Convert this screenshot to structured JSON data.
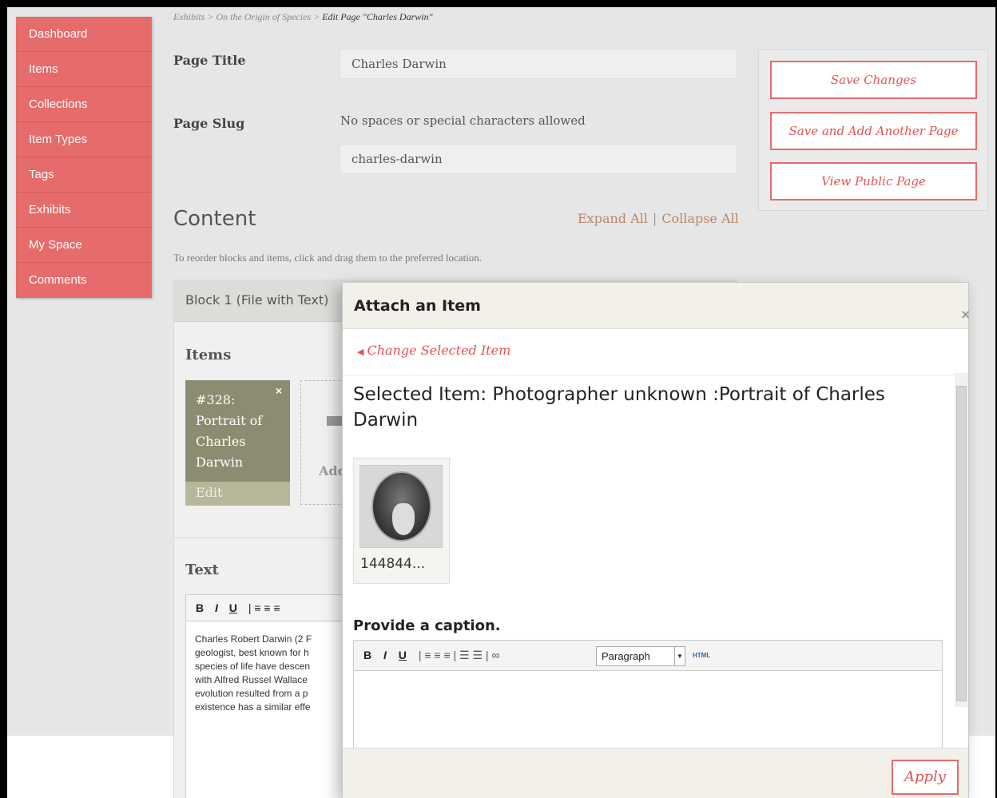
{
  "sidebar": {
    "items": [
      {
        "label": "Dashboard"
      },
      {
        "label": "Items"
      },
      {
        "label": "Collections"
      },
      {
        "label": "Item Types"
      },
      {
        "label": "Tags"
      },
      {
        "label": "Exhibits"
      },
      {
        "label": "My Space"
      },
      {
        "label": "Comments"
      }
    ]
  },
  "breadcrumb": {
    "part1": "Exhibits",
    "sep": " > ",
    "part2": "On the Origin of Species",
    "current": "Edit Page \"Charles Darwin\""
  },
  "form": {
    "page_title_label": "Page Title",
    "page_title_value": "Charles Darwin",
    "page_slug_label": "Page Slug",
    "slug_hint": "No spaces or special characters allowed",
    "page_slug_value": "charles-darwin"
  },
  "actions": {
    "save": "Save Changes",
    "save_add": "Save and Add Another Page",
    "view_public": "View Public Page"
  },
  "content": {
    "heading": "Content",
    "expand_all": "Expand All",
    "separator": "|",
    "collapse_all": "Collapse All",
    "reorder_hint": "To reorder blocks and items, click and drag them to the preferred location."
  },
  "block": {
    "header": "Block 1 (File with Text)",
    "items_heading": "Items",
    "item_card_text": "#328: Portrait of Charles Darwin",
    "item_card_line1": "#328:",
    "item_card_line2": "Portrait of",
    "item_card_line3": "Charles",
    "item_card_line4": "Darwin",
    "remove_glyph": "×",
    "edit_label": "Edit",
    "add_item_label": "Add",
    "text_heading": "Text",
    "editor_text": "Charles Robert Darwin (2 F\ngeologist, best known for h\nspecies of life have descen\nwith Alfred Russel Wallace\nevolution resulted from a p\nexistence has a similar effe"
  },
  "modal": {
    "title": "Attach an Item",
    "close_glyph": "×",
    "change_link": "Change Selected Item",
    "selected_title": "Selected Item: Photographer unknown :Portrait of Charles Darwin",
    "thumb_label": "144844...",
    "caption_heading": "Provide a caption.",
    "format_select": "Paragraph",
    "html_label": "HTML",
    "apply": "Apply"
  }
}
